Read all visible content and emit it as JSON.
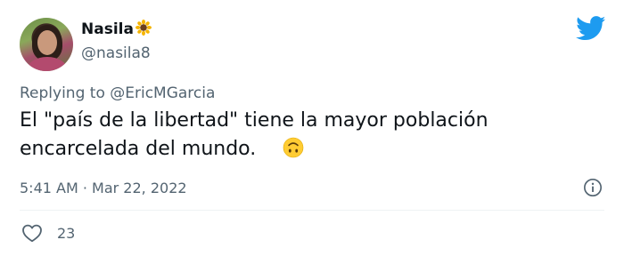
{
  "tweet": {
    "author_name": "Nasila",
    "name_emoji": "sunflower-icon",
    "handle": "@nasila8",
    "reply_prefix": "Replying to ",
    "reply_mention": "@EricMGarcia",
    "text_line1": "El \"país de la libertad\" tiene la mayor población",
    "text_line2": "encarcelada del mundo.",
    "text_emoji": "upside-down-face-icon",
    "timestamp": "5:41 AM · Mar 22, 2022",
    "like_count": "23"
  },
  "colors": {
    "twitter_blue": "#1d9bf0",
    "text_primary": "#0f1419",
    "text_secondary": "#536471",
    "divider": "#eff3f4"
  },
  "icons": {
    "brand": "twitter-bird-icon",
    "info": "info-icon",
    "like": "heart-icon"
  }
}
